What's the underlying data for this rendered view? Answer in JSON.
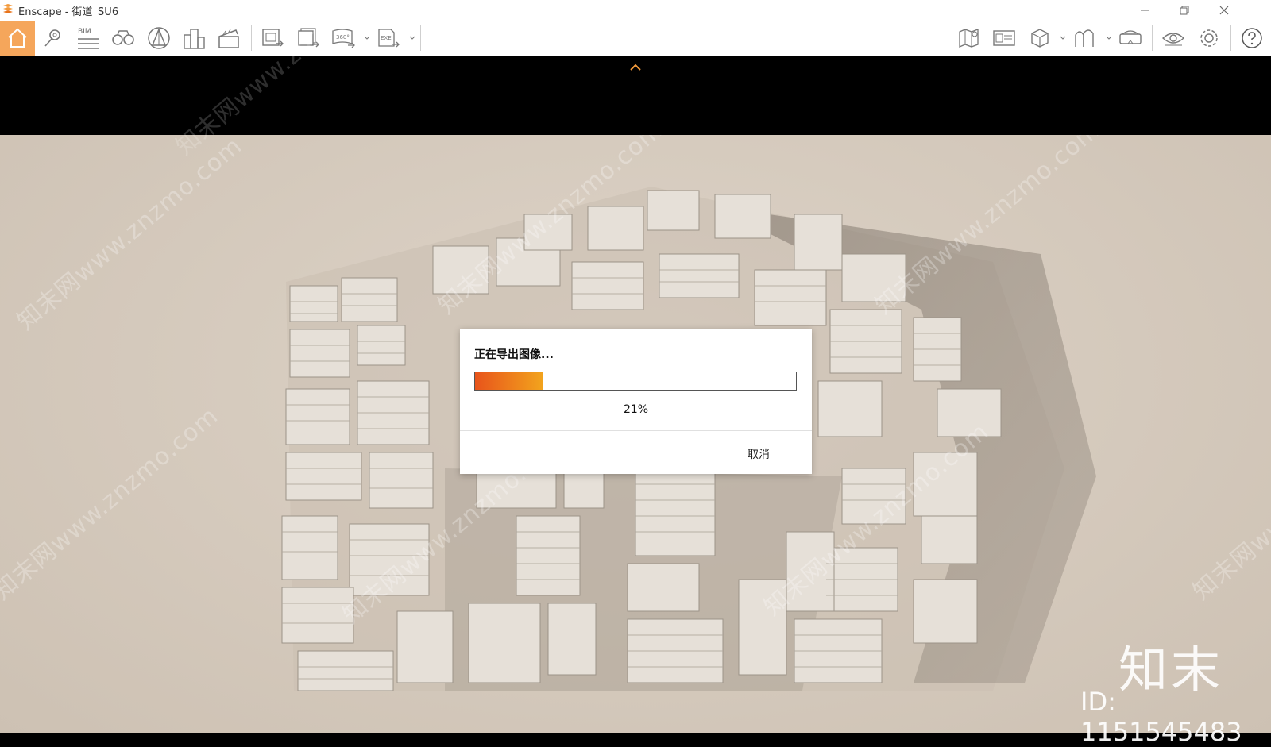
{
  "window": {
    "title": "Enscape - 街道_SU6"
  },
  "toolbar": {
    "left_icons": [
      "home-icon",
      "location-pin-icon",
      "bim-icon",
      "binoculars-icon",
      "perspective-icon",
      "buildings-icon",
      "clapper-icon",
      "screenshot-export-icon",
      "batch-export-icon",
      "export-360-icon",
      "export-exe-icon"
    ],
    "right_icons": [
      "map-icon",
      "panel-icon",
      "cube-icon",
      "asset-library-icon",
      "vr-headset-icon",
      "eye-icon",
      "gear-icon",
      "help-icon"
    ],
    "bim_label": "BIM",
    "label_360": "360°",
    "label_exe": "EXE",
    "accent_color": "#f39a3b"
  },
  "dialog": {
    "message": "正在导出图像...",
    "progress": 0.21,
    "progress_text": "21%",
    "cancel_label": "取消",
    "bar_colors": [
      "#e8541b",
      "#f2a31d"
    ]
  },
  "watermark": {
    "site": "知末网www.znzmo.com",
    "brand": "知末",
    "id_text": "ID: 1151545483"
  }
}
